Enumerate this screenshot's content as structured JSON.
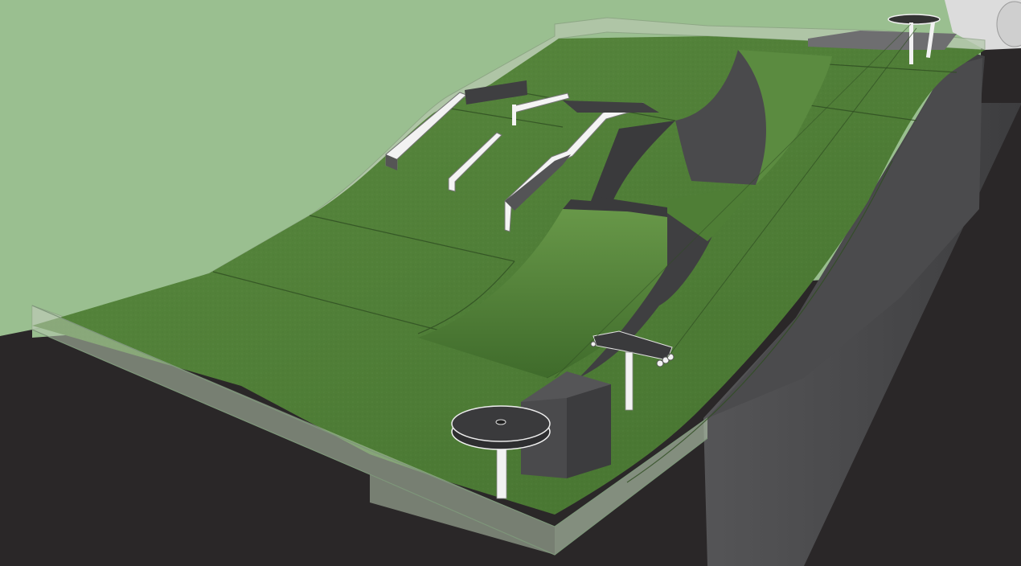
{
  "scene": {
    "description_label": "",
    "colors": {
      "sky": "#9abf90",
      "ground": "#2a2728",
      "turf": "#4f7d38",
      "turf_light": "#5e8d42",
      "turf_dark": "#3e6a2c",
      "wall": "#4a4a4c",
      "wall_light": "#5c5c5e",
      "glass": "#b8c9b0",
      "rail": "#f2f2f2",
      "rail_shadow": "#6b6b6b",
      "platform": "#3a3a3c"
    }
  }
}
